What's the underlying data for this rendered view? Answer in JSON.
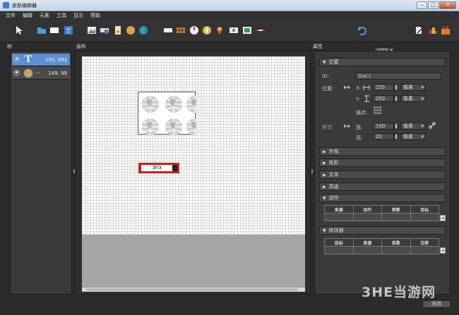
{
  "window": {
    "title": "皮肤编辑器",
    "min": "‒",
    "max": "□",
    "close": "✕"
  },
  "menu": [
    "文件",
    "编辑",
    "元素",
    "工具",
    "显示",
    "帮助"
  ],
  "toolbar": {
    "zoom": "100%"
  },
  "panels": {
    "tree": "树",
    "canvas": "画布",
    "props": "属性"
  },
  "tree": {
    "items": [
      {
        "label": "155, 293",
        "icon": "text-icon",
        "selected": true
      },
      {
        "label": "149, 99",
        "icon": "image-icon",
        "ellipsis": "···",
        "selected": false
      }
    ]
  },
  "canvas": {
    "text_element": "3h3"
  },
  "props": {
    "position_section": "位置",
    "id_label": "ID:",
    "id_value": "Text 1",
    "pos_label": "位置:",
    "x_label": "X:",
    "x_value": "155",
    "x_unit": "像素",
    "y_label": "Y:",
    "y_value": "293",
    "y_unit": "像素",
    "anchor_label": "锚点:",
    "size_label": "尺寸:",
    "w_label": "宽:",
    "w_value": "100",
    "w_unit": "像素",
    "h_label": "高:",
    "h_value": "20",
    "h_unit": "像素",
    "collapsed_sections": [
      "外观",
      "矩形",
      "文本",
      "高级"
    ],
    "actions_section": "动作",
    "actions_cols": [
      "来源",
      "动作",
      "参数",
      "目标"
    ],
    "modifiers_section": "修改器",
    "modifiers_cols": [
      "目标",
      "来源",
      "系数",
      "位移"
    ]
  },
  "footer": {
    "close": "关闭"
  },
  "watermark": "3HE当游网"
}
